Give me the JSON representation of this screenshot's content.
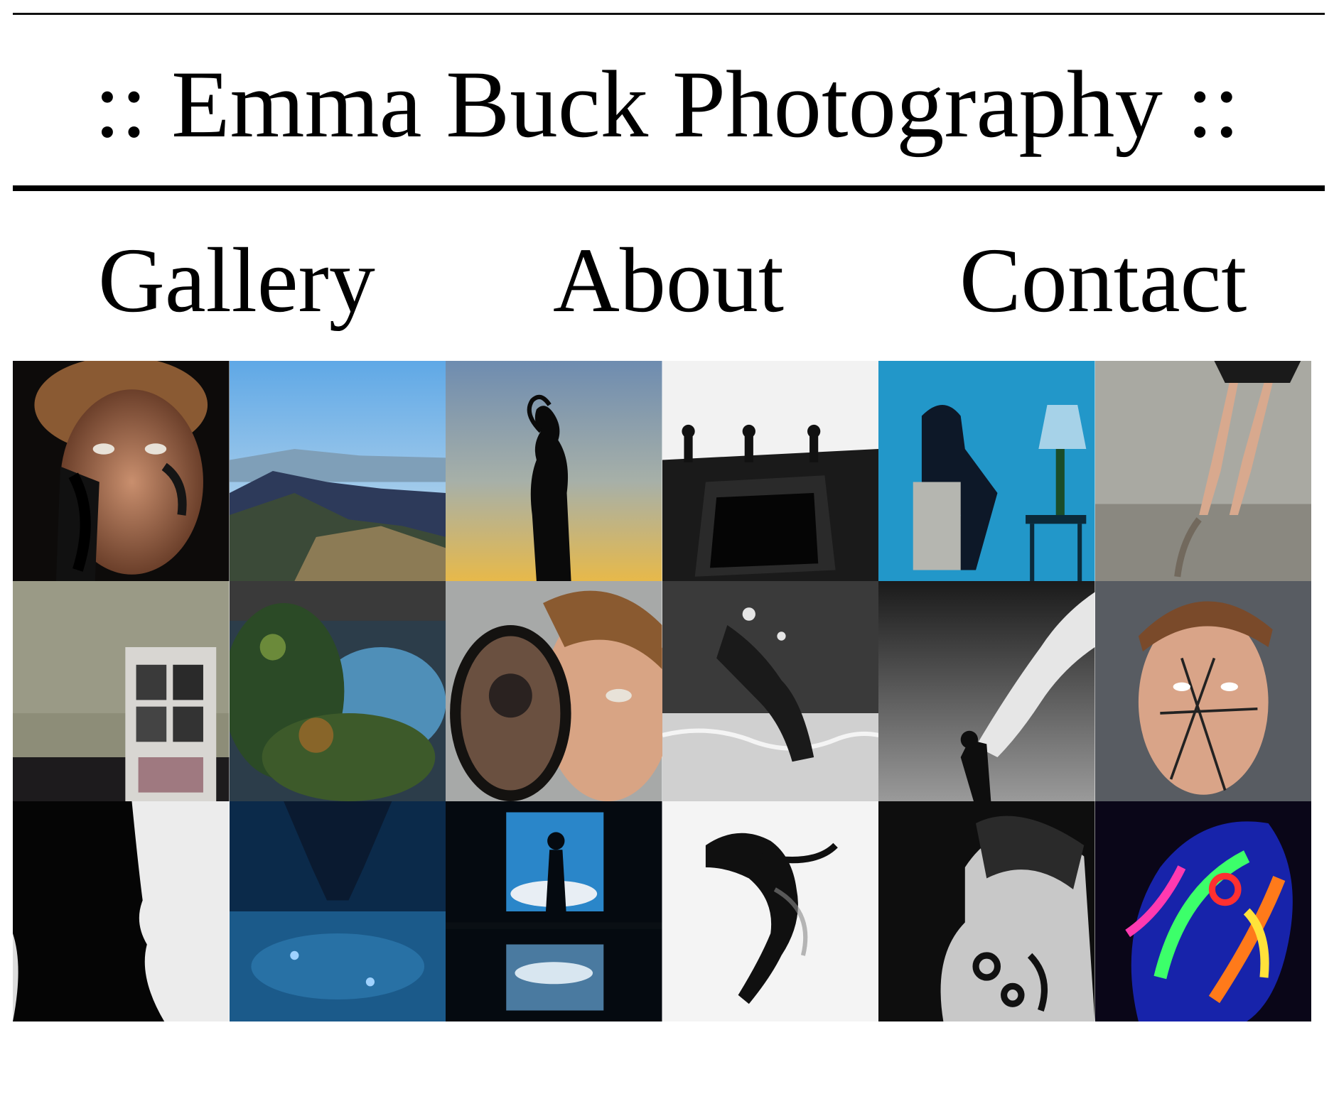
{
  "site": {
    "title": ":: Emma Buck Photography ::"
  },
  "nav": {
    "items": [
      "Gallery",
      "About",
      "Contact"
    ]
  },
  "gallery": {
    "photos": [
      {
        "name": "portrait-face-paint-photo"
      },
      {
        "name": "mountain-landscape-photo"
      },
      {
        "name": "sunset-silhouette-photo"
      },
      {
        "name": "rooftop-pool-bw-photo"
      },
      {
        "name": "underwater-suit-lamp-photo"
      },
      {
        "name": "ballet-pointe-photo"
      },
      {
        "name": "abandoned-door-photo"
      },
      {
        "name": "upside-down-trees-photo"
      },
      {
        "name": "mirror-portrait-photo"
      },
      {
        "name": "underwater-bw-swimmer-photo"
      },
      {
        "name": "flowing-fabric-photo"
      },
      {
        "name": "written-face-portrait-photo"
      },
      {
        "name": "kiss-silhouette-photo"
      },
      {
        "name": "upside-down-pool-photo"
      },
      {
        "name": "window-silhouette-photo"
      },
      {
        "name": "falling-dancer-photo"
      },
      {
        "name": "back-paint-portrait-photo"
      },
      {
        "name": "neon-body-paint-photo"
      }
    ]
  }
}
